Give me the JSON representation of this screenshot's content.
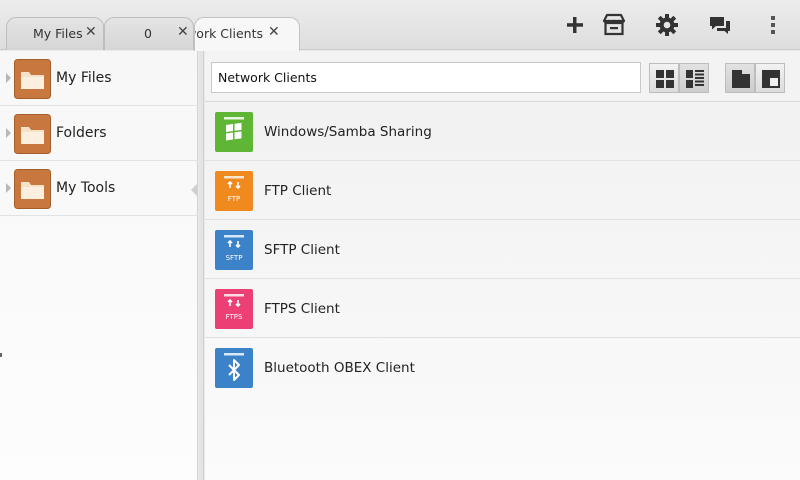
{
  "tabs": [
    {
      "label": "My Files",
      "close": "✕"
    },
    {
      "label": "0",
      "close": "✕"
    },
    {
      "label": "Network Clients",
      "close": "✕"
    }
  ],
  "toolbar_icons": [
    "add-icon",
    "store-icon",
    "gear-icon",
    "chat-icon",
    "more-icon"
  ],
  "sidebar": {
    "items": [
      {
        "label": "My Files",
        "icon": "folder-icon"
      },
      {
        "label": "Folders",
        "icon": "folder-icon"
      },
      {
        "label": "My Tools",
        "icon": "folder-icon"
      }
    ]
  },
  "main": {
    "path_value": "Network Clients",
    "view_buttons": [
      "grid-view",
      "list-view",
      "layout-a",
      "layout-b"
    ],
    "items": [
      {
        "label": "Windows/Samba Sharing",
        "icon": "windows-icon",
        "color": "#5fb534",
        "badge": ""
      },
      {
        "label": "FTP Client",
        "icon": "ftp-icon",
        "color": "#f08a1e",
        "badge": "FTP"
      },
      {
        "label": "SFTP Client",
        "icon": "sftp-icon",
        "color": "#3b82c8",
        "badge": "SFTP"
      },
      {
        "label": "FTPS Client",
        "icon": "ftps-icon",
        "color": "#ec3f73",
        "badge": "FTPS"
      },
      {
        "label": "Bluetooth OBEX Client",
        "icon": "bluetooth-icon",
        "color": "#3b82c8",
        "badge": ""
      }
    ]
  },
  "colors": {
    "folder": "#c8783e",
    "folder_light": "#f6e2c9"
  }
}
